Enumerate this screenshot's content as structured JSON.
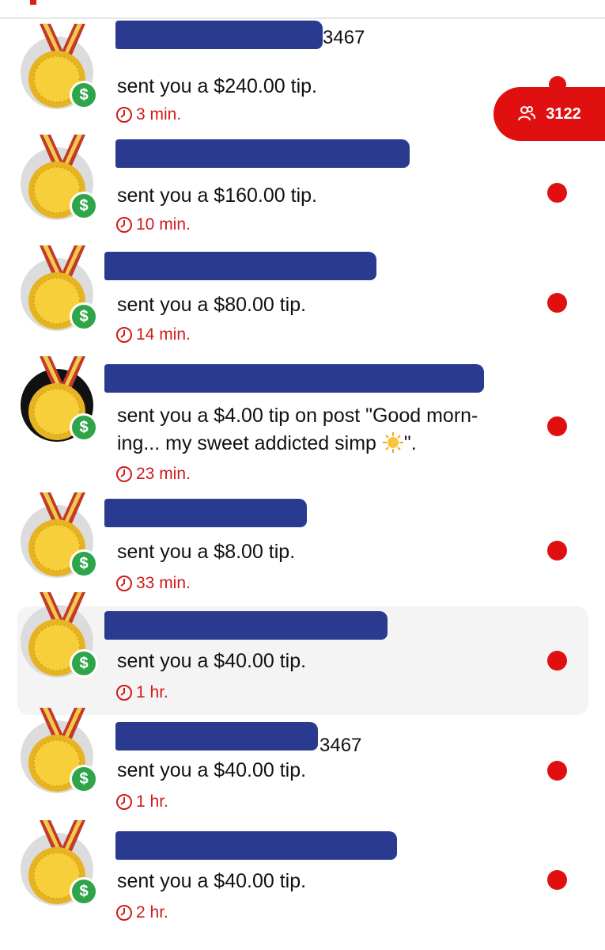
{
  "badge": {
    "count": "3122",
    "icon": "users-icon"
  },
  "notifications": [
    {
      "name_suffix": "3467",
      "message": "sent you a $240.00 tip.",
      "time": "3 min."
    },
    {
      "name_suffix": "",
      "message": "sent you a $160.00 tip.",
      "time": "10 min."
    },
    {
      "name_suffix": "",
      "message": "sent you a $80.00 tip.",
      "time": "14 min."
    },
    {
      "name_suffix": "",
      "message_line1": "sent you a $4.00 tip on post \"Good morn-",
      "message_line2_before": "ing... my sweet addicted simp ",
      "message_line2_after": "\".",
      "time": "23 min."
    },
    {
      "name_suffix": "",
      "message": "sent you a $8.00 tip.",
      "time": "33 min."
    },
    {
      "name_suffix": "",
      "message": "sent you a $40.00 tip.",
      "time": "1 hr."
    },
    {
      "name_suffix": "3467",
      "message": "sent you a $40.00 tip.",
      "time": "1 hr."
    },
    {
      "name_suffix": "",
      "message": "sent you a $40.00 tip.",
      "time": "2 hr."
    }
  ],
  "colors": {
    "accent": "#e01010",
    "redaction": "#2a3a8f",
    "money": "#2fa54a"
  }
}
